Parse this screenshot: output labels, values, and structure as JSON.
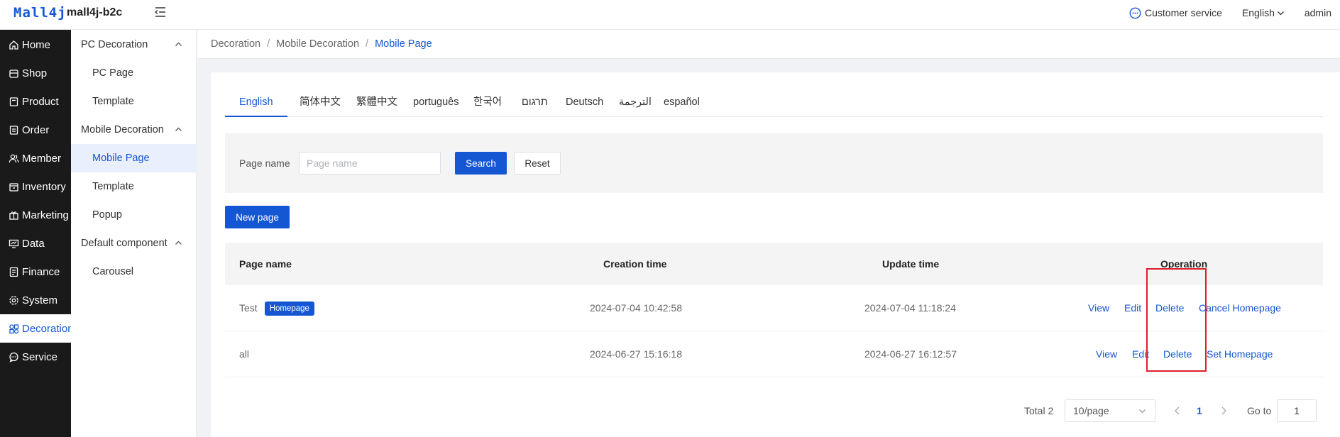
{
  "header": {
    "logo": "Mall4j",
    "app_name": "mall4j-b2c",
    "customer_service": "Customer service",
    "language": "English",
    "user": "admin"
  },
  "sidebar": {
    "items": [
      {
        "label": "Home",
        "icon": "home-icon"
      },
      {
        "label": "Shop",
        "icon": "shop-icon"
      },
      {
        "label": "Product",
        "icon": "product-icon"
      },
      {
        "label": "Order",
        "icon": "order-icon"
      },
      {
        "label": "Member",
        "icon": "member-icon"
      },
      {
        "label": "Inventory",
        "icon": "inventory-icon"
      },
      {
        "label": "Marketing",
        "icon": "marketing-icon"
      },
      {
        "label": "Data",
        "icon": "data-icon"
      },
      {
        "label": "Finance",
        "icon": "finance-icon"
      },
      {
        "label": "System",
        "icon": "system-icon"
      },
      {
        "label": "Decoration",
        "icon": "decoration-icon"
      },
      {
        "label": "Service",
        "icon": "service-icon"
      }
    ],
    "active": "Decoration"
  },
  "submenu": {
    "groups": [
      {
        "label": "PC Decoration",
        "items": [
          "PC Page",
          "Template"
        ]
      },
      {
        "label": "Mobile Decoration",
        "items": [
          "Mobile Page",
          "Template",
          "Popup"
        ]
      },
      {
        "label": "Default component",
        "items": [
          "Carousel"
        ]
      }
    ],
    "active": "Mobile Page"
  },
  "breadcrumb": [
    "Decoration",
    "Mobile Decoration",
    "Mobile Page"
  ],
  "language_tabs": [
    "English",
    "简体中文",
    "繁體中文",
    "português",
    "한국어",
    "תרגום",
    "Deutsch",
    "الترجمة",
    "español"
  ],
  "active_tab": "English",
  "filter": {
    "label": "Page name",
    "placeholder": "Page name",
    "search_button": "Search",
    "reset_button": "Reset"
  },
  "new_page_button": "New page",
  "table": {
    "columns": [
      "Page name",
      "Creation time",
      "Update time",
      "Operation"
    ],
    "rows": [
      {
        "name": "Test",
        "badge": "Homepage",
        "created": "2024-07-04 10:42:58",
        "updated": "2024-07-04 11:18:24",
        "actions": [
          "View",
          "Edit",
          "Delete",
          "Cancel Homepage"
        ]
      },
      {
        "name": "all",
        "badge": "",
        "created": "2024-06-27 15:16:18",
        "updated": "2024-06-27 16:12:57",
        "actions": [
          "View",
          "Edit",
          "Delete",
          "Set Homepage"
        ]
      }
    ]
  },
  "pagination": {
    "total": "Total 2",
    "page_size": "10/page",
    "current_page": "1",
    "goto_label": "Go to",
    "goto_value": "1"
  },
  "colors": {
    "accent": "#1557d3",
    "sidebar_bg": "#1a1a1a",
    "highlight_box": "#e01e2c"
  }
}
